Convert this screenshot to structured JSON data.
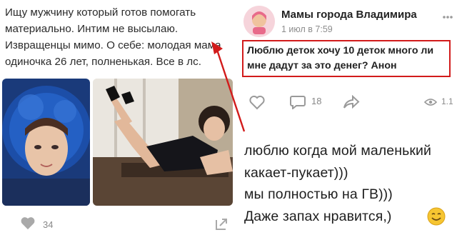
{
  "left_post": {
    "text_lines": [
      "Ищу мужчину который готов помогать",
      "материально. Интим не высылаю.",
      "Извращенцы мимо. О себе: молодая мама",
      "одиночка 26 лет, полненькая. Все в лс."
    ],
    "likes_count": "34"
  },
  "right_post": {
    "group_name": "Мамы города Владимира",
    "date": "1 июл в 7:59",
    "body_lines": [
      "Люблю деток хочу 10 деток много ли",
      "мне дадут за это денег? Анон"
    ],
    "comments_count": "18",
    "views_count": "1.1"
  },
  "comment": {
    "lines": [
      "люблю когда мой маленький",
      "какает-пукает)))",
      "мы полностью на ГВ)))",
      "Даже запах нравится,)"
    ]
  },
  "colors": {
    "highlight_border": "#d21b1b",
    "arrow": "#d21b1b",
    "icon_gray": "#9a9a9a"
  }
}
